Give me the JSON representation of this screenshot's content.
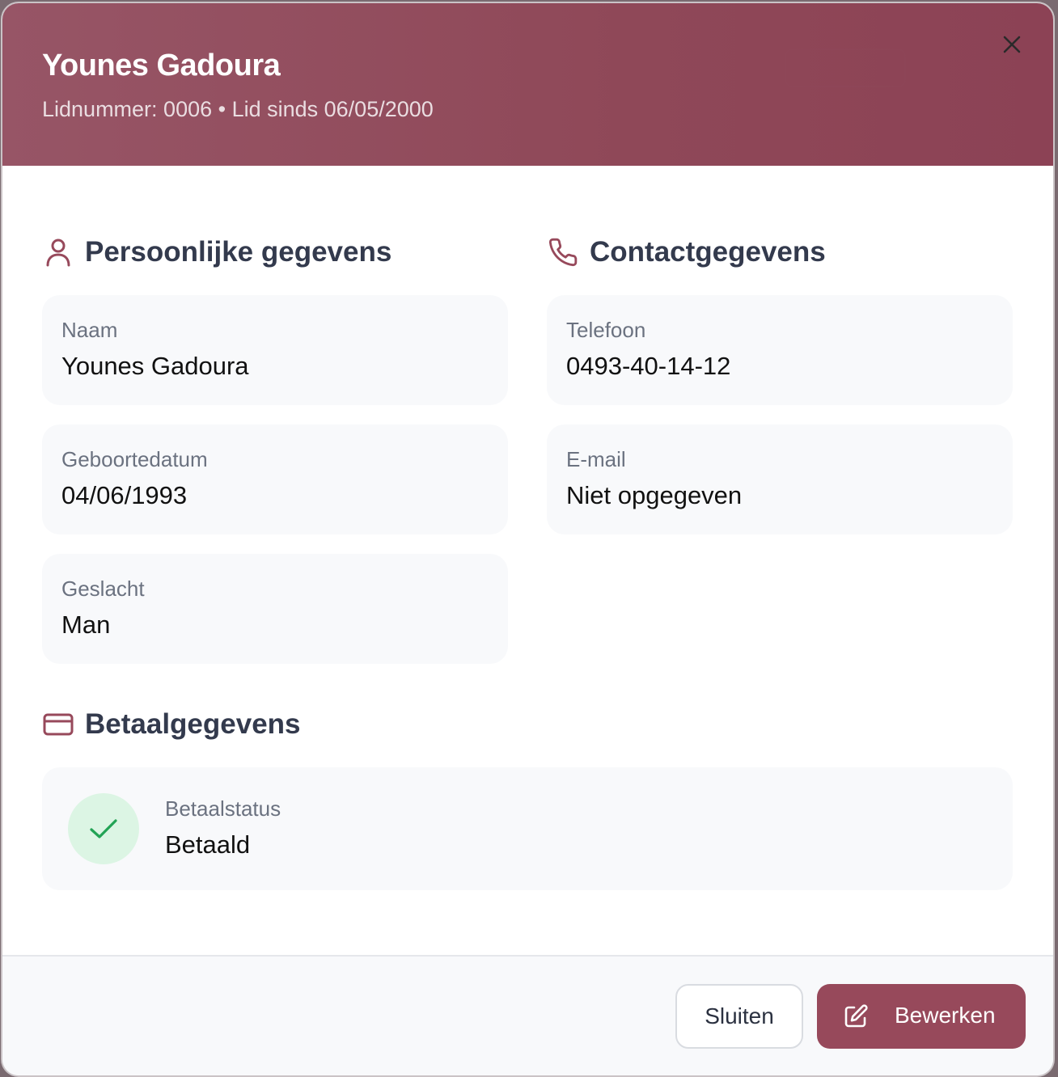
{
  "header": {
    "title": "Younes Gadoura",
    "subtitle": "Lidnummer: 0006 • Lid sinds 06/05/2000",
    "color": "#914b5c"
  },
  "personal": {
    "heading": "Persoonlijke gegevens",
    "icon": "user-icon",
    "fields": [
      {
        "label": "Naam",
        "value": "Younes Gadoura"
      },
      {
        "label": "Geboortedatum",
        "value": "04/06/1993"
      },
      {
        "label": "Geslacht",
        "value": "Man"
      }
    ]
  },
  "contact": {
    "heading": "Contactgegevens",
    "icon": "phone-icon",
    "fields": [
      {
        "label": "Telefoon",
        "value": "0493-40-14-12"
      },
      {
        "label": "E-mail",
        "value": "Niet opgegeven"
      }
    ]
  },
  "payment": {
    "heading": "Betaalgegevens",
    "icon": "credit-card-icon",
    "status_label": "Betaalstatus",
    "status_value": "Betaald",
    "status_icon": "check-icon",
    "status_color": "#22a355"
  },
  "footer": {
    "close_label": "Sluiten",
    "edit_label": "Bewerken",
    "edit_icon": "edit-icon",
    "accent": "#97495b"
  }
}
